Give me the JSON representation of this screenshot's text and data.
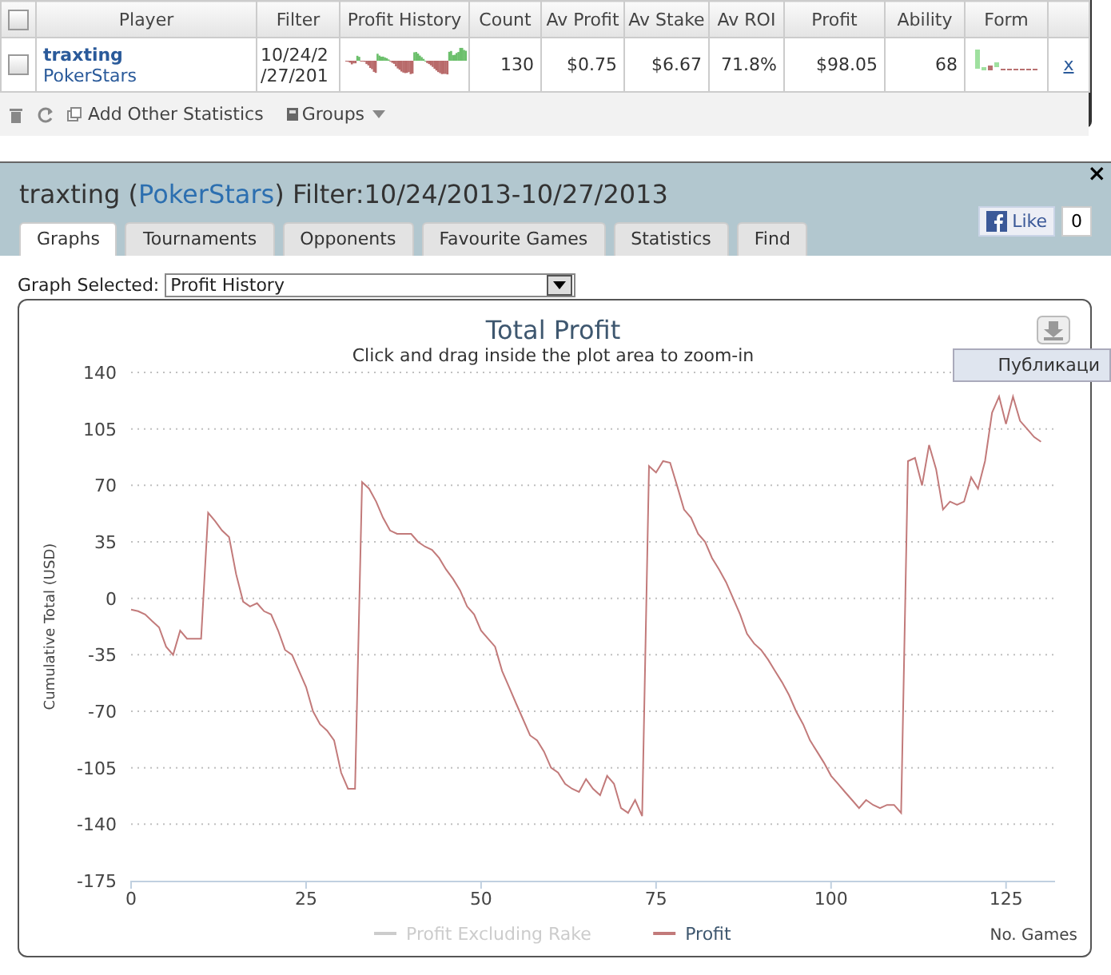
{
  "stats_table": {
    "all_checked": false,
    "columns": [
      "Player",
      "Filter",
      "Profit History",
      "Count",
      "Av Profit",
      "Av Stake",
      "Av ROI",
      "Profit",
      "Ability",
      "Form"
    ],
    "rows": [
      {
        "checked": false,
        "player": "traxting",
        "site": "PokerStars",
        "filter": [
          "10/24/2",
          "/27/201"
        ],
        "count": "130",
        "av_profit": "$0.75",
        "av_stake": "$6.67",
        "av_roi": "71.8%",
        "profit": "$98.05",
        "ability": "68",
        "remove": "x"
      }
    ],
    "toolbar": {
      "add_label": "Add Other Statistics",
      "groups_label": "Groups"
    }
  },
  "dialog": {
    "player": "traxting",
    "site": "PokerStars",
    "site_brackets": [
      "(",
      ")"
    ],
    "filter": "Filter:10/24/2013-10/27/2013",
    "close": "×",
    "like": {
      "label": "Like",
      "count": "0"
    },
    "tabs": [
      {
        "label": "Graphs",
        "selected": true
      },
      {
        "label": "Tournaments",
        "selected": false
      },
      {
        "label": "Opponents",
        "selected": false
      },
      {
        "label": "Favourite Games",
        "selected": false
      },
      {
        "label": "Statistics",
        "selected": false
      },
      {
        "label": "Find",
        "selected": false
      }
    ],
    "graph_select": {
      "label": "Graph Selected:",
      "value": "Profit History"
    },
    "tooltip": "Публикаци",
    "legend": [
      {
        "label": "Profit Excluding Rake",
        "enabled": false
      }
    ],
    "chart_data": {
      "type": "line",
      "title": "Total Profit",
      "subtitle": "Click and drag inside the plot area to zoom-in",
      "xlabel": "No. Games",
      "ylabel": "Cumulative Total (USD)",
      "grid": true,
      "x": [
        0,
        1,
        2,
        3,
        4,
        5,
        6,
        7,
        8,
        9,
        10,
        11,
        12,
        13,
        14,
        15,
        16,
        17,
        18,
        19,
        20,
        21,
        22,
        23,
        24,
        25,
        26,
        27,
        28,
        29,
        30,
        31,
        32,
        33,
        34,
        35,
        36,
        37,
        38,
        39,
        40,
        41,
        42,
        43,
        44,
        45,
        46,
        47,
        48,
        49,
        50,
        51,
        52,
        53,
        54,
        55,
        56,
        57,
        58,
        59,
        60,
        61,
        62,
        63,
        64,
        65,
        66,
        67,
        68,
        69,
        70,
        71,
        72,
        73,
        74,
        75,
        76,
        77,
        78,
        79,
        80,
        81,
        82,
        83,
        84,
        85,
        86,
        87,
        88,
        89,
        90,
        91,
        92,
        93,
        94,
        95,
        96,
        97,
        98,
        99,
        100,
        101,
        102,
        103,
        104,
        105,
        106,
        107,
        108,
        109,
        110,
        111,
        112,
        113,
        114,
        115,
        116,
        117,
        118,
        119,
        120,
        121,
        122,
        123,
        124,
        125,
        126,
        127,
        128,
        129,
        130
      ],
      "xlim": [
        0,
        132
      ],
      "ylim": [
        -175,
        140
      ],
      "xticks": [
        0,
        25,
        50,
        75,
        100,
        125
      ],
      "yticks": [
        -175,
        -140,
        -105,
        -70,
        -35,
        0,
        35,
        70,
        105,
        140
      ],
      "series": [
        {
          "name": "Profit",
          "color": "#c27a7a",
          "values": [
            -7,
            -8,
            -10,
            -14,
            -18,
            -30,
            -35,
            -20,
            -25,
            -25,
            -25,
            53,
            48,
            42,
            38,
            15,
            -2,
            -5,
            -3,
            -8,
            -10,
            -20,
            -32,
            -35,
            -45,
            -55,
            -70,
            -78,
            -82,
            -88,
            -108,
            -118,
            -118,
            72,
            68,
            60,
            50,
            42,
            40,
            40,
            40,
            35,
            32,
            30,
            25,
            18,
            12,
            5,
            -5,
            -10,
            -20,
            -25,
            -30,
            -45,
            -55,
            -65,
            -75,
            -85,
            -88,
            -95,
            -105,
            -108,
            -115,
            -118,
            -120,
            -112,
            -118,
            -122,
            -110,
            -115,
            -130,
            -133,
            -125,
            -135,
            82,
            78,
            85,
            84,
            70,
            55,
            50,
            40,
            35,
            25,
            18,
            10,
            0,
            -10,
            -22,
            -28,
            -32,
            -38,
            -45,
            -52,
            -60,
            -70,
            -78,
            -88,
            -95,
            -102,
            -110,
            -115,
            -120,
            -125,
            -130,
            -125,
            -128,
            -130,
            -128,
            -128,
            -133,
            85,
            87,
            70,
            95,
            80,
            55,
            60,
            58,
            60,
            75,
            68,
            85,
            115,
            125,
            108,
            125,
            110,
            105,
            100,
            97
          ]
        }
      ]
    }
  }
}
